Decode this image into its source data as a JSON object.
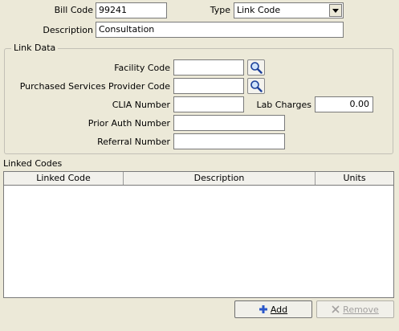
{
  "header": {
    "bill_code_label": "Bill Code",
    "bill_code_value": "99241",
    "type_label": "Type",
    "type_value": "Link Code",
    "description_label": "Description",
    "description_value": "Consultation"
  },
  "link_data": {
    "title": "Link Data",
    "facility_code_label": "Facility Code",
    "facility_code_value": "",
    "psp_code_label": "Purchased Services Provider Code",
    "psp_code_value": "",
    "clia_label": "CLIA Number",
    "clia_value": "",
    "lab_charges_label": "Lab Charges",
    "lab_charges_value": "0.00",
    "prior_auth_label": "Prior Auth Number",
    "prior_auth_value": "",
    "referral_label": "Referral Number",
    "referral_value": ""
  },
  "linked_codes": {
    "title": "Linked Codes",
    "columns": [
      "Linked Code",
      "Description",
      "Units"
    ],
    "rows": []
  },
  "buttons": {
    "add_label": "Add",
    "remove_label": "Remove"
  },
  "icons": {
    "lookup": "magnifier-icon",
    "dropdown": "chevron-down-icon",
    "add": "plus-icon",
    "remove": "x-icon"
  },
  "colors": {
    "window_bg": "#ece9d8",
    "add_icon": "#2b57c9"
  }
}
